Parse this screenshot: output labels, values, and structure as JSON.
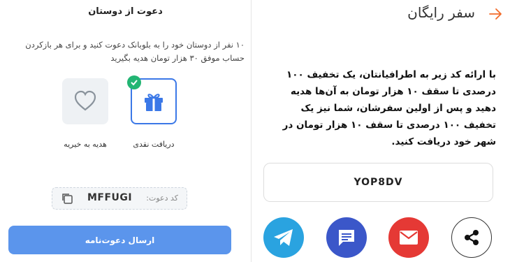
{
  "right": {
    "title": "سفر رایگان",
    "description": "با ارائه کد زیر به اطرافیانتان، یک تخفیف ۱۰۰ درصدی تا سقف ۱۰ هزار تومان به آن‌ها هدیه دهید و پس از اولین سفرشان، شما نیز یک تخفیف ۱۰۰ درصدی تا سقف ۱۰ هزار تومان در شهر خود دریافت کنید.",
    "promo_code": "YOP8DV",
    "share_buttons": [
      "share-icon",
      "email-icon",
      "message-icon",
      "telegram-icon"
    ]
  },
  "left": {
    "title": "دعوت از دوستان",
    "description": "۱۰ نفر از دوستان خود را به بلوبانک دعوت کنید و برای هر بازکردن حساب موفق ۳۰ هزار تومان هدیه بگیرید",
    "options": [
      {
        "label": "دریافت نقدی",
        "icon": "gift-icon",
        "selected": true
      },
      {
        "label": "هدیه به خیریه",
        "icon": "heart-icon",
        "selected": false
      }
    ],
    "invite_label": "کد دعوت:",
    "invite_code": "MFFUGI",
    "send_button": "ارسال دعوت‌نامه"
  },
  "colors": {
    "accent": "#f26b2a",
    "primary": "#5b95ec",
    "check": "#22b573"
  }
}
